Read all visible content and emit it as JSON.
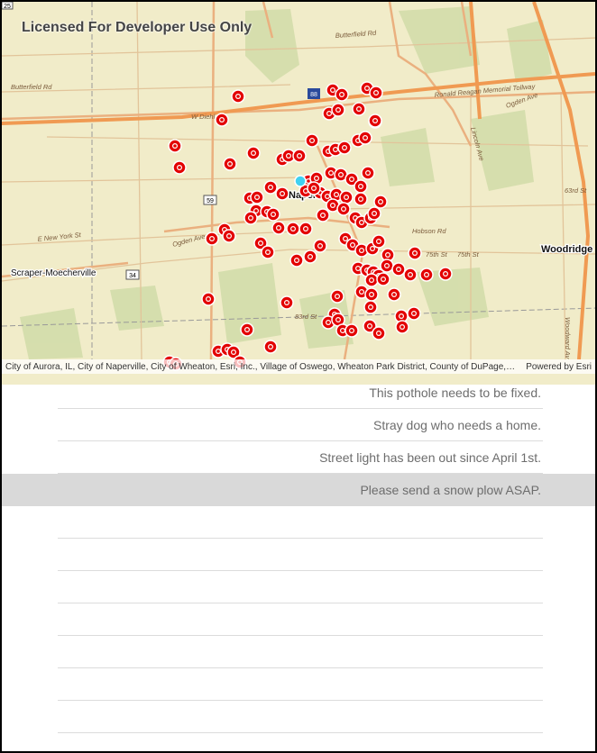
{
  "map": {
    "watermark": "Licensed For Developer Use Only",
    "places": [
      {
        "id": "naperville",
        "label": "Naperville"
      },
      {
        "id": "woodridge",
        "label": "Woodridge"
      },
      {
        "id": "scraper",
        "label": "Scraper-Moecherville"
      }
    ],
    "road_labels": [
      "Butterfield Rd",
      "Butterfield Rd",
      "Ronald Reagan Memorial Tollway",
      "Ogden Ave",
      "W Diehl Rd",
      "Lincoln Ave",
      "E New York St",
      "Ogden Ave",
      "Hobson Rd",
      "75th St",
      "75th St",
      "63rd St",
      "Woodward Av",
      "83rd St"
    ],
    "shields": [
      "25",
      "88",
      "59",
      "34"
    ],
    "attribution": "City of Aurora, IL, City of Naperville, City of Wheaton, Esri, Inc., Village of Oswego, Wheaton Park District, County of DuPage, Count...",
    "powered_by": "Powered by Esri",
    "colors": {
      "base": "#f1ecc9",
      "green": "#cfdca6",
      "highway": "#f0a05a",
      "road": "#e8b88a",
      "marker": "#e30000",
      "location": "#3fd1f1"
    }
  },
  "list": {
    "items": [
      {
        "text": "This pothole needs to be fixed.",
        "selected": false
      },
      {
        "text": "Stray dog who needs a home.",
        "selected": false
      },
      {
        "text": "Street light has been out since April 1st.",
        "selected": false
      },
      {
        "text": "Please send a snow plow ASAP.",
        "selected": true
      },
      {
        "text": "",
        "selected": false
      },
      {
        "text": "",
        "selected": false
      },
      {
        "text": "",
        "selected": false
      },
      {
        "text": "",
        "selected": false
      },
      {
        "text": "",
        "selected": false
      },
      {
        "text": "",
        "selected": false
      },
      {
        "text": "",
        "selected": false
      }
    ]
  }
}
